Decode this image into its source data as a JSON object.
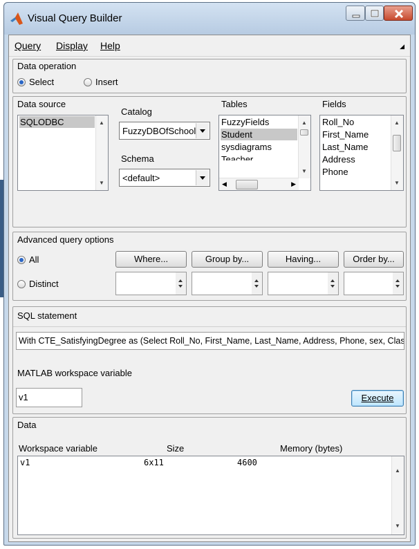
{
  "window": {
    "title": "Visual Query Builder"
  },
  "menu": {
    "query": "Query",
    "display": "Display",
    "help": "Help"
  },
  "data_operation": {
    "title": "Data operation",
    "select_label": "Select",
    "insert_label": "Insert",
    "selected": "Select"
  },
  "data_source": {
    "label": "Data source",
    "items": [
      "SQLODBC"
    ],
    "selected": "SQLODBC"
  },
  "catalog": {
    "label": "Catalog",
    "value": "FuzzyDBOfSchool"
  },
  "schema": {
    "label": "Schema",
    "value": "<default>"
  },
  "tables": {
    "label": "Tables",
    "items": [
      "FuzzyFields",
      "Student",
      "sysdiagrams",
      "Teacher"
    ],
    "selected": "Student"
  },
  "fields": {
    "label": "Fields",
    "items": [
      "Roll_No",
      "First_Name",
      "Last_Name",
      "Address",
      "Phone"
    ]
  },
  "advanced": {
    "title": "Advanced query options",
    "all_label": "All",
    "distinct_label": "Distinct",
    "where_button": "Where...",
    "groupby_button": "Group by...",
    "having_button": "Having...",
    "orderby_button": "Order by..."
  },
  "sql": {
    "title": "SQL statement",
    "statement": "With CTE_SatisfyingDegree as (Select Roll_No, First_Name, Last_Name, Address, Phone, sex, Class,"
  },
  "workspace": {
    "label": "MATLAB workspace variable",
    "value": "v1",
    "execute_button": "Execute"
  },
  "data": {
    "title": "Data",
    "columns": {
      "variable": "Workspace variable",
      "size": "Size",
      "memory": "Memory (bytes)"
    },
    "rows": [
      {
        "variable": "v1",
        "size": "6x11",
        "memory": "4600"
      }
    ]
  }
}
